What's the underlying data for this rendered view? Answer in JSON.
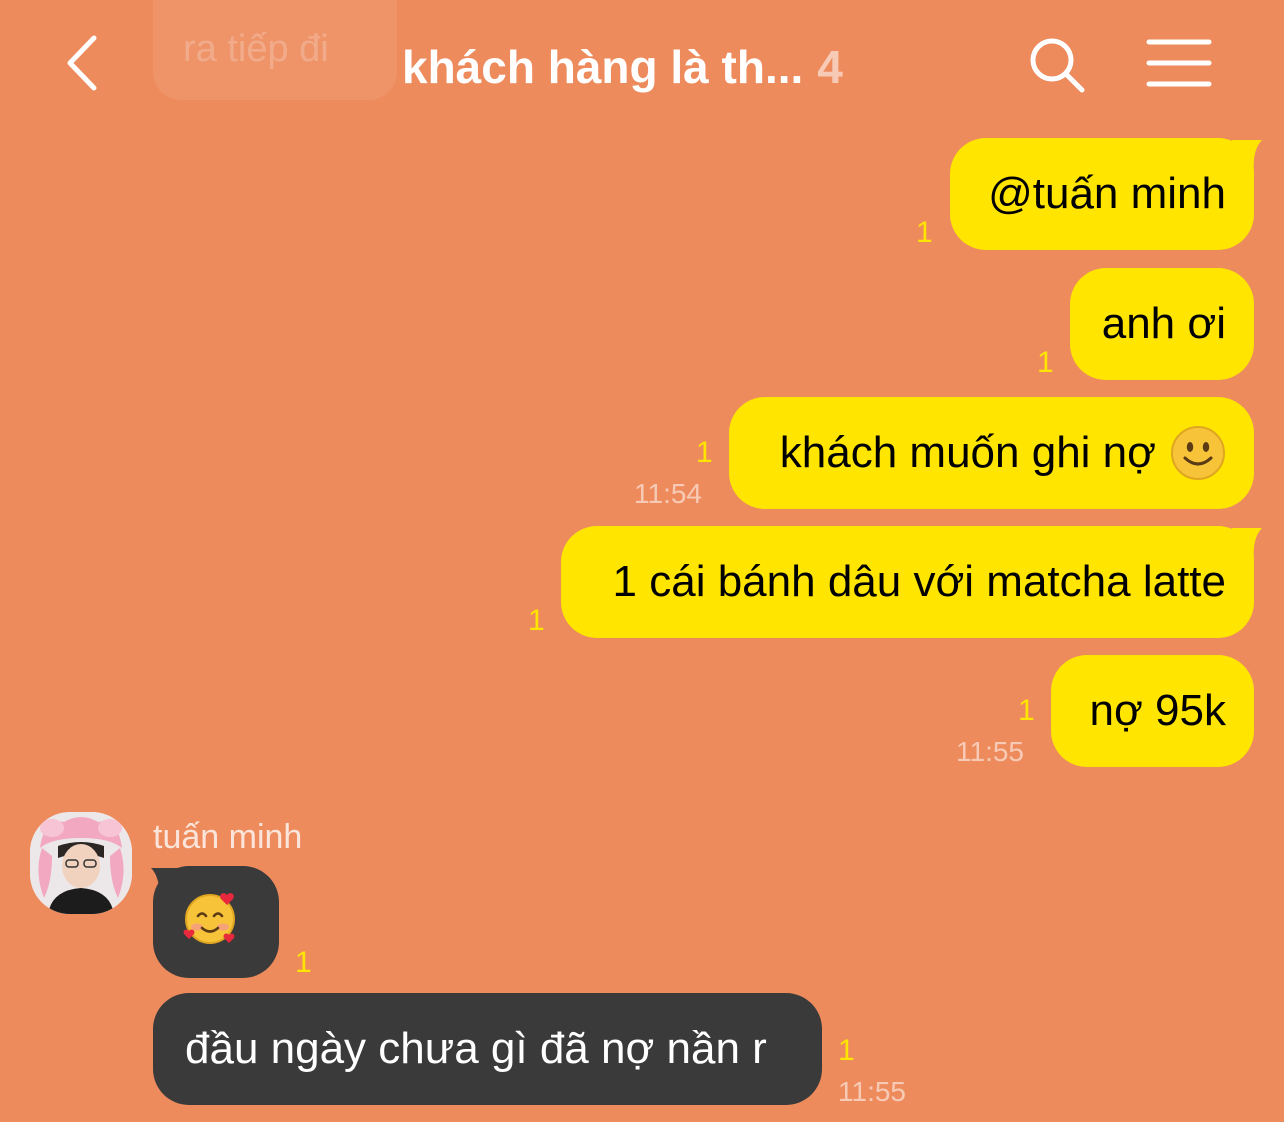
{
  "header": {
    "title": "khách hàng là th...",
    "member_count": "4",
    "faded_preview": "ra tiếp đi"
  },
  "messages_out": [
    {
      "text": "@tuấn minh",
      "unread": "1",
      "time": ""
    },
    {
      "text": "anh ơi",
      "unread": "1",
      "time": ""
    },
    {
      "text": "khách muốn ghi nợ",
      "emoji": "slightly-smiling-face",
      "unread": "1",
      "time": "11:54"
    },
    {
      "text": "1 cái bánh dâu với matcha latte",
      "unread": "1",
      "time": ""
    },
    {
      "text": "nợ 95k",
      "unread": "1",
      "time": "11:55"
    }
  ],
  "sender": {
    "name": "tuấn minh"
  },
  "messages_in": [
    {
      "emoji": "🥰",
      "unread": "1",
      "time": ""
    },
    {
      "text": "đầu ngày chưa gì đã nợ nần r",
      "unread": "1",
      "time": "11:55"
    }
  ],
  "colors": {
    "background": "#EE8B5D",
    "outgoing_bubble": "#FFE500",
    "incoming_bubble": "#3A3A3A",
    "unread_count": "#FFE500"
  }
}
